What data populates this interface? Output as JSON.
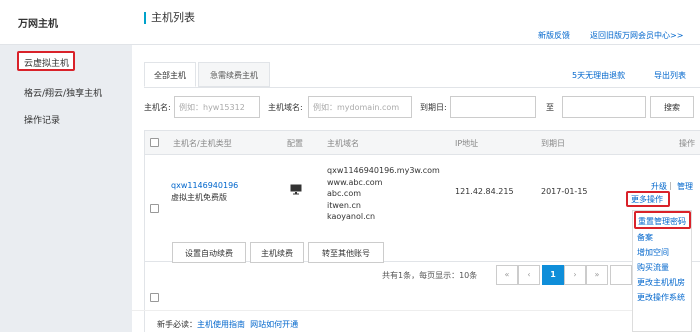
{
  "sidebar": {
    "title": "万网主机",
    "items": [
      {
        "label": "云虚拟主机"
      },
      {
        "label": "格云/翔云/独享主机"
      },
      {
        "label": "操作记录"
      }
    ]
  },
  "header": {
    "title": "主机列表",
    "feedback": "新版反馈",
    "return_old": "返回旧版万网会员中心>>"
  },
  "tabs": [
    {
      "label": "全部主机"
    },
    {
      "label": "急需续费主机"
    }
  ],
  "tab_links": {
    "refund": "5天无理由退款",
    "export": "导出列表"
  },
  "filters": {
    "host_name_label": "主机名:",
    "host_name_placeholder": "例如：hyw15312",
    "domain_label": "主机域名:",
    "domain_placeholder": "例如：mydomain.com",
    "expire_label": "到期日:",
    "to_label": "至",
    "search_button": "搜索"
  },
  "table": {
    "headers": [
      "主机名/主机类型",
      "配置",
      "主机域名",
      "IP地址",
      "到期日",
      "操作"
    ],
    "row": {
      "host_name": "qxw1146940196",
      "host_type": "虚拟主机免费版",
      "domains": [
        "qxw1146940196.my3w.com",
        "www.abc.com",
        "abc.com",
        "itwen.cn",
        "kaoyanol.cn"
      ],
      "ip": "121.42.84.215",
      "expire": "2017-01-15",
      "ops_upgrade": "升级",
      "ops_sep": "|",
      "ops_manage": "管理",
      "ops_more": "更多操作"
    },
    "footer_buttons": [
      "设置自动续费",
      "主机续费",
      "转至其他账号"
    ],
    "pagination": {
      "summary": "共有1条，每页显示：10条",
      "first": "«",
      "prev": "‹",
      "current": "1",
      "next": "›",
      "last": "»"
    }
  },
  "dropdown": {
    "items": [
      "重置管理密码",
      "备案",
      "增加空间",
      "购买流量",
      "更改主机机房",
      "更改操作系统"
    ]
  },
  "newbie": {
    "label": "新手必读：",
    "link1": "主机使用指南",
    "link2": "网站如何开通"
  },
  "colors": {
    "accent": "#0066cc",
    "highlight_box": "#d9222a",
    "pager_active": "#0f8ed9"
  }
}
